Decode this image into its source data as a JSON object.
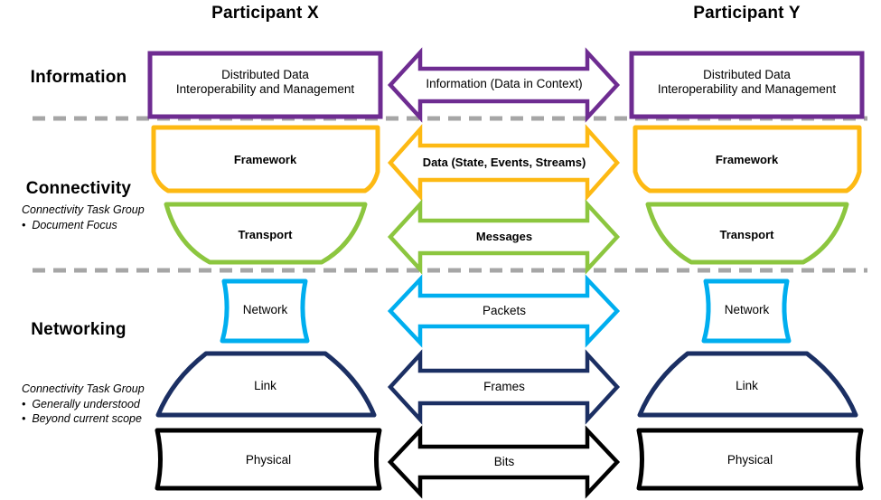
{
  "diagram": {
    "title_left": "Participant X",
    "title_right": "Participant Y",
    "bands": [
      {
        "name": "Information",
        "label": "Information"
      },
      {
        "name": "Connectivity",
        "label": "Connectivity"
      },
      {
        "name": "Networking",
        "label": "Networking"
      }
    ],
    "notes": [
      {
        "heading": "Connectivity Task Group",
        "bullets": [
          "Document Focus"
        ]
      },
      {
        "heading": "Connectivity Task Group",
        "bullets": [
          "Generally understood",
          "Beyond current scope"
        ]
      }
    ],
    "layers": [
      {
        "id": "information",
        "stack_label": "Distributed Data\nInteroperability and Management",
        "flow_label": "Information (Data in Context)",
        "color": "#6E2C91",
        "stack_bold": false,
        "flow_bold": false
      },
      {
        "id": "framework",
        "stack_label": "Framework",
        "flow_label": "Data (State, Events, Streams)",
        "color": "#FDB913",
        "stack_bold": true,
        "flow_bold": true
      },
      {
        "id": "transport",
        "stack_label": "Transport",
        "flow_label": "Messages",
        "color": "#8CC63F",
        "stack_bold": true,
        "flow_bold": true
      },
      {
        "id": "network",
        "stack_label": "Network",
        "flow_label": "Packets",
        "color": "#00AEEF",
        "stack_bold": false,
        "flow_bold": false
      },
      {
        "id": "link",
        "stack_label": "Link",
        "flow_label": "Frames",
        "color": "#1B2F63",
        "stack_bold": false,
        "flow_bold": false
      },
      {
        "id": "physical",
        "stack_label": "Physical",
        "flow_label": "Bits",
        "color": "#000000",
        "stack_bold": false,
        "flow_bold": false
      }
    ],
    "divider_color": "#A6A6A6",
    "background": "#FFFFFF"
  }
}
